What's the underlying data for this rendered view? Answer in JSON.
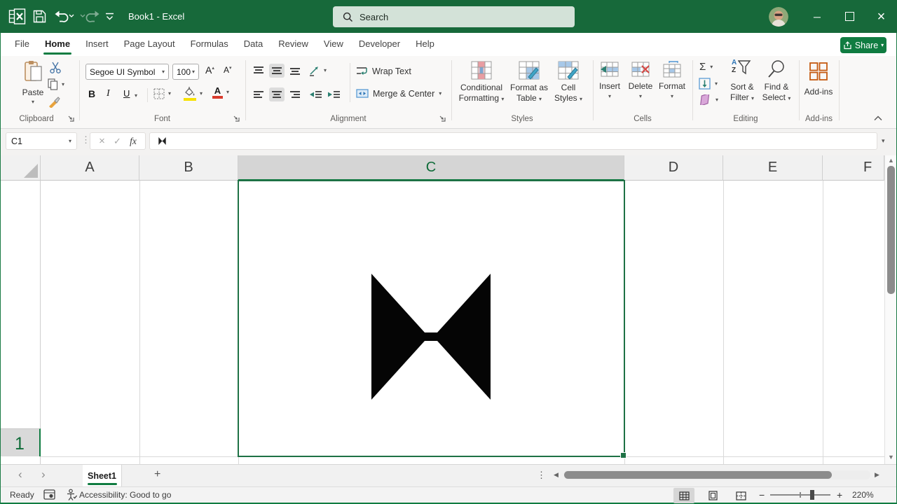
{
  "colors": {
    "accent": "#107C41",
    "titlebar_green": "#17693A",
    "selection_green": "#1E7145",
    "fill_yellow": "#F7E100",
    "font_red": "#D83B2D"
  },
  "title_bar": {
    "title": "Book1 - Excel",
    "search_placeholder": "Search"
  },
  "menu": {
    "tabs": [
      "File",
      "Home",
      "Insert",
      "Page Layout",
      "Formulas",
      "Data",
      "Review",
      "View",
      "Developer",
      "Help"
    ],
    "active_tab": "Home",
    "share_label": "Share"
  },
  "ribbon": {
    "clipboard": {
      "group_label": "Clipboard",
      "paste_label": "Paste"
    },
    "font": {
      "group_label": "Font",
      "font_name": "Segoe UI Symbol",
      "font_size": "100",
      "bold": "B",
      "italic": "I",
      "underline": "U",
      "grow": "A",
      "shrink": "A",
      "color_letter": "A"
    },
    "alignment": {
      "group_label": "Alignment",
      "wrap_text": "Wrap Text",
      "merge_center": "Merge & Center"
    },
    "styles": {
      "group_label": "Styles",
      "conditional_1": "Conditional",
      "conditional_2": "Formatting",
      "table_1": "Format as",
      "table_2": "Table",
      "cellstyles_1": "Cell",
      "cellstyles_2": "Styles"
    },
    "cells": {
      "group_label": "Cells",
      "insert": "Insert",
      "delete": "Delete",
      "format": "Format"
    },
    "editing": {
      "group_label": "Editing",
      "autosum": "Σ",
      "sort_1": "Sort &",
      "sort_2": "Filter",
      "find_1": "Find &",
      "find_2": "Select",
      "sort_a": "A",
      "sort_z": "Z"
    },
    "addins": {
      "group_label": "Add-ins",
      "button_label": "Add-ins"
    }
  },
  "formula_bar": {
    "cell_reference": "C1",
    "fx": "fx",
    "cancel": "×",
    "enter": "✓",
    "content_char": "⧓"
  },
  "grid": {
    "columns": [
      "A",
      "B",
      "C",
      "D",
      "E",
      "F"
    ],
    "selected_column": "C",
    "selected_cell": "C1",
    "row_number": "1",
    "cell_value": "⧓"
  },
  "sheet_bar": {
    "sheet_name": "Sheet1"
  },
  "status_bar": {
    "status": "Ready",
    "accessibility": "Accessibility: Good to go",
    "zoom_level": "220%"
  },
  "icons": {
    "chevron_down": "▾",
    "chevron_up": "▴",
    "nav_left": "‹",
    "nav_right": "›",
    "tri_left": "◀",
    "tri_right": "▶",
    "tri_up": "▲",
    "tri_down": "▼",
    "dots_v": "⋮",
    "plus": "+",
    "minus": "−",
    "close": "×",
    "min": "─"
  }
}
